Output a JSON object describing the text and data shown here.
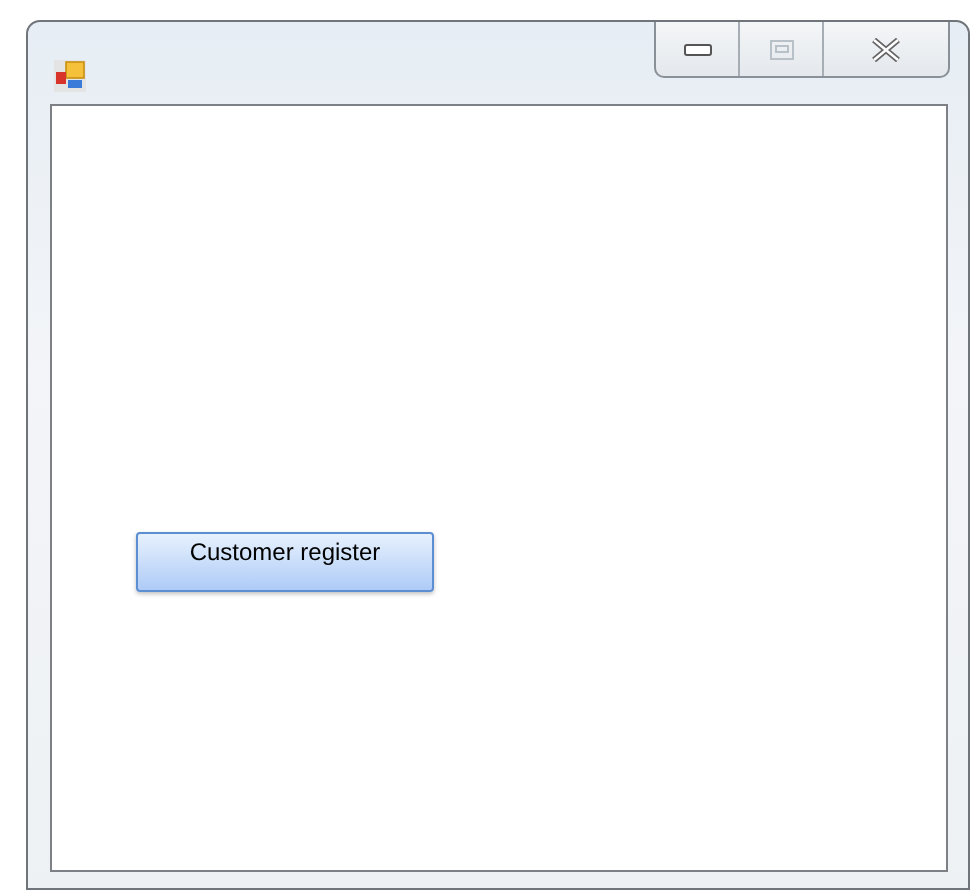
{
  "window": {
    "caption_buttons": [
      {
        "kind": "minimize",
        "disabled": false
      },
      {
        "kind": "maximize",
        "disabled": true
      },
      {
        "kind": "close",
        "disabled": false
      }
    ]
  },
  "form": {
    "button": {
      "label": "Customer register"
    }
  }
}
